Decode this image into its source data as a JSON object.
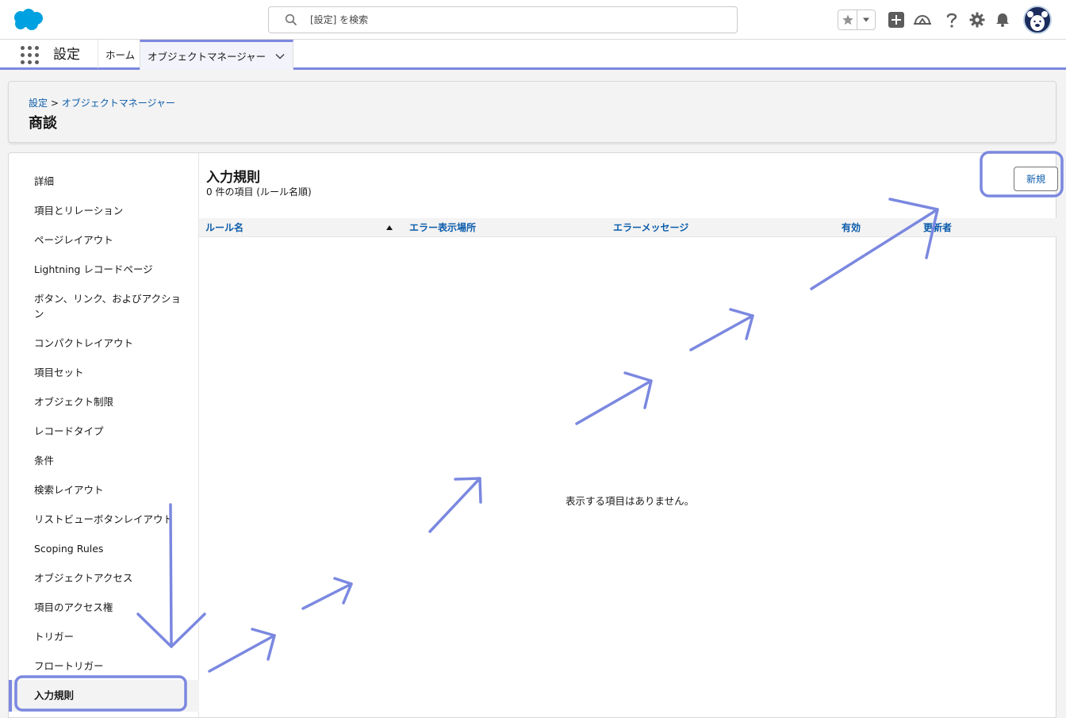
{
  "header": {
    "search_placeholder": "[設定] を検索"
  },
  "app_nav": {
    "app_name": "設定",
    "home_label": "ホーム",
    "object_manager_label": "オブジェクトマネージャー"
  },
  "page_header": {
    "breadcrumb_root": "設定",
    "breadcrumb_separator": ">",
    "breadcrumb_current": "オブジェクトマネージャー",
    "title": "商談"
  },
  "sidebar": {
    "items": [
      {
        "label": "詳細"
      },
      {
        "label": "項目とリレーション"
      },
      {
        "label": "ページレイアウト"
      },
      {
        "label": "Lightning レコードページ"
      },
      {
        "label": "ボタン、リンク、およびアクション"
      },
      {
        "label": "コンパクトレイアウト"
      },
      {
        "label": "項目セット"
      },
      {
        "label": "オブジェクト制限"
      },
      {
        "label": "レコードタイプ"
      },
      {
        "label": "条件"
      },
      {
        "label": "検索レイアウト"
      },
      {
        "label": "リストビューボタンレイアウト"
      },
      {
        "label": "Scoping Rules"
      },
      {
        "label": "オブジェクトアクセス"
      },
      {
        "label": "項目のアクセス権"
      },
      {
        "label": "トリガー"
      },
      {
        "label": "フロートリガー"
      },
      {
        "label": "入力規則"
      }
    ],
    "active_index": 17
  },
  "main": {
    "title": "入力規則",
    "subtitle": "0 件の項目 (ルール名順)",
    "new_button_label": "新規",
    "columns": [
      "ルール名",
      "エラー表示場所",
      "エラーメッセージ",
      "有効",
      "更新者"
    ],
    "empty_message": "表示する項目はありません。"
  },
  "colors": {
    "brand": "#00a1e0",
    "link": "#0b5cab",
    "annotation": "#7b88e0",
    "avatar_bg": "#1b2c5c"
  },
  "icons": [
    "salesforce-cloud-logo",
    "search-icon",
    "star-icon",
    "chevron-down-icon",
    "plus-icon",
    "trailhead-icon",
    "help-icon",
    "gear-icon",
    "bell-icon",
    "avatar",
    "app-launcher-icon",
    "sort-ascending-icon"
  ]
}
